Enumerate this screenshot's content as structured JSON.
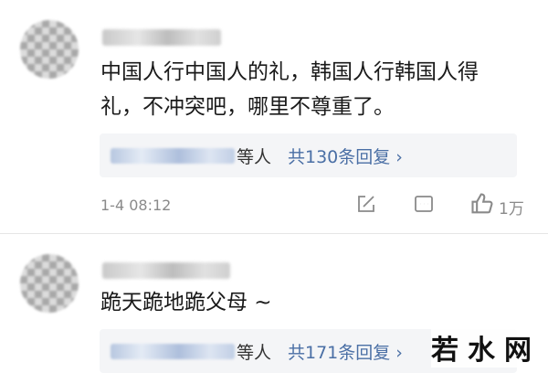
{
  "comments": [
    {
      "text_line1": "中国人行中国人的礼，韩国人行韩国人得",
      "text_line2": "礼，不冲突吧，哪里不尊重了。",
      "reply_who": "等人",
      "reply_count": "共130条回复 ›",
      "timestamp": "1-4 08:12",
      "likes": "1万"
    },
    {
      "text_line1": "跪天跪地跪父母 ~",
      "reply_who": "等人",
      "reply_count": "共171条回复 ›"
    }
  ],
  "watermark": "若水网",
  "colors": {
    "reply_link": "#4a6fa5",
    "meta": "#8a8a8a",
    "reply_bg": "#f4f5f7"
  },
  "icons": [
    "share-icon",
    "comment-icon",
    "like-icon"
  ]
}
